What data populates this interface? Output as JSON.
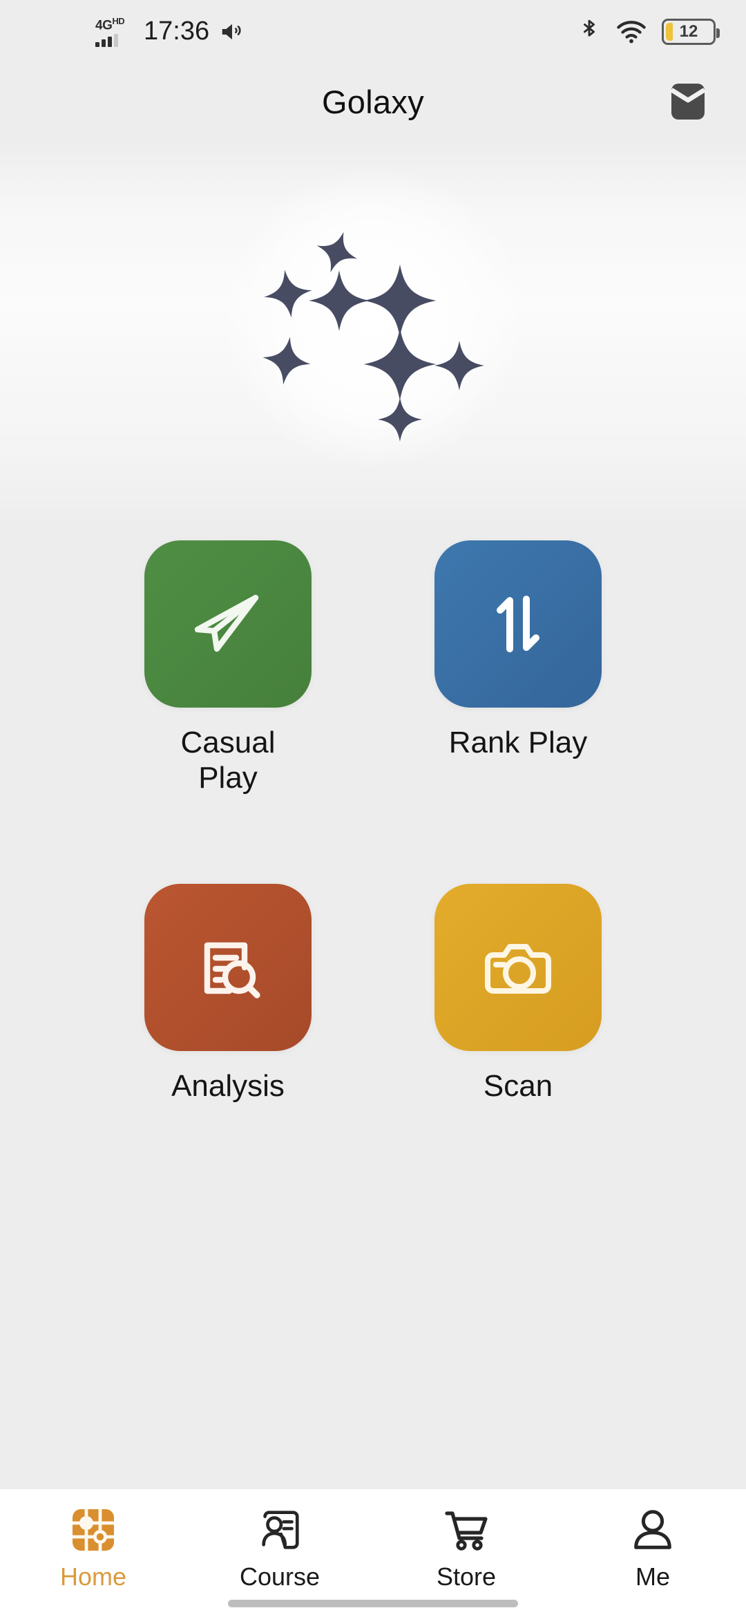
{
  "status_bar": {
    "network_type": "4G",
    "network_suffix": "HD",
    "time": "17:36",
    "volume_icon": "volume-mute-icon",
    "bluetooth_icon": "bluetooth-icon",
    "wifi_icon": "wifi-icon",
    "battery_level": "12",
    "battery_color": "#eec33a"
  },
  "header": {
    "title": "Golaxy",
    "action_icon": "mail-envelope-icon"
  },
  "hero": {
    "logo_icon": "sparkle-constellation-logo",
    "logo_color": "#474c63"
  },
  "main": {
    "tiles": [
      {
        "label": "Casual Play",
        "icon": "paper-plane-icon",
        "color": "#4d8a42",
        "color_end": "#47803d"
      },
      {
        "label": "Rank Play",
        "icon": "rank-updown-arrows-icon",
        "color": "#3a72a8",
        "color_end": "#35689b"
      },
      {
        "label": "Analysis",
        "icon": "document-search-icon",
        "color": "#b5512e",
        "color_end": "#a74b2a"
      },
      {
        "label": "Scan",
        "icon": "camera-icon",
        "color": "#dfa828",
        "color_end": "#d89f22"
      }
    ]
  },
  "bottom_nav": {
    "active_color": "#d99b3c",
    "items": [
      {
        "label": "Home",
        "icon": "go-board-grid-icon",
        "active": true
      },
      {
        "label": "Course",
        "icon": "id-card-person-icon",
        "active": false
      },
      {
        "label": "Store",
        "icon": "shopping-cart-icon",
        "active": false
      },
      {
        "label": "Me",
        "icon": "user-person-icon",
        "active": false
      }
    ]
  }
}
